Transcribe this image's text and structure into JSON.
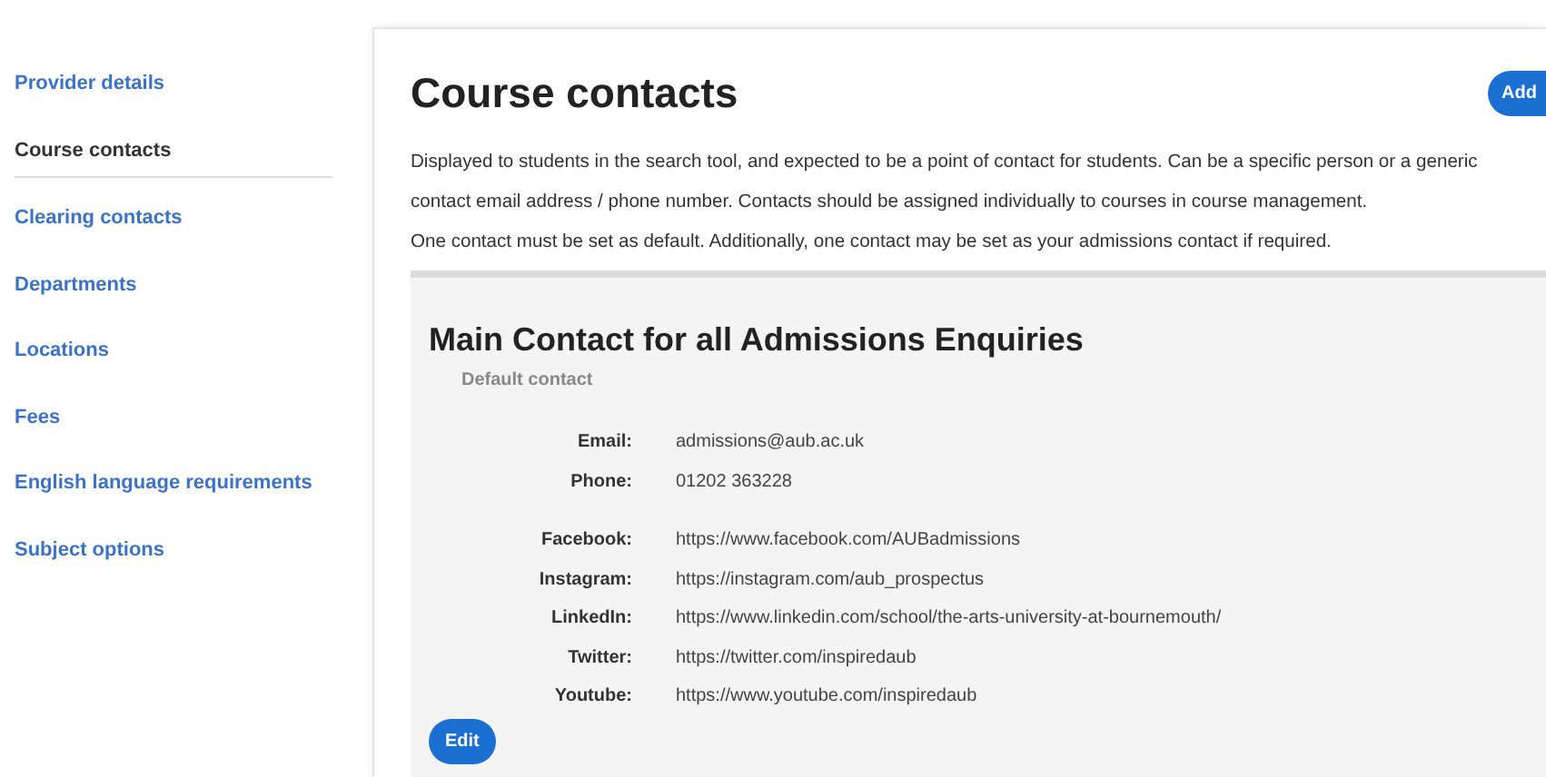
{
  "sidebar": {
    "items": [
      {
        "label": "Provider details",
        "selected": false
      },
      {
        "label": "Course contacts",
        "selected": true
      },
      {
        "label": "Clearing contacts",
        "selected": false
      },
      {
        "label": "Departments",
        "selected": false
      },
      {
        "label": "Locations",
        "selected": false
      },
      {
        "label": "Fees",
        "selected": false
      },
      {
        "label": "English language requirements",
        "selected": false
      },
      {
        "label": "Subject options",
        "selected": false
      }
    ]
  },
  "main": {
    "title": "Course contacts",
    "add_button": "Add",
    "description": [
      "Displayed to students in the search tool, and expected to be a point of contact for students. Can be a specific person or a generic contact email address / phone number. Contacts should be assigned individually to courses in course management.",
      "One contact must be set as default. Additionally, one contact may be set as your admissions contact if required."
    ],
    "contact": {
      "title": "Main Contact for all Admissions Enquiries",
      "subtitle": "Default contact",
      "groups": [
        [
          {
            "label": "Email:",
            "value": "admissions@aub.ac.uk"
          },
          {
            "label": "Phone:",
            "value": "01202 363228"
          }
        ],
        [
          {
            "label": "Facebook:",
            "value": "https://www.facebook.com/AUBadmissions"
          },
          {
            "label": "Instagram:",
            "value": "https://instagram.com/aub_prospectus"
          },
          {
            "label": "LinkedIn:",
            "value": "https://www.linkedin.com/school/the-arts-university-at-bournemouth/"
          },
          {
            "label": "Twitter:",
            "value": "https://twitter.com/inspiredaub"
          },
          {
            "label": "Youtube:",
            "value": "https://www.youtube.com/inspiredaub"
          }
        ]
      ],
      "edit_button": "Edit"
    }
  }
}
